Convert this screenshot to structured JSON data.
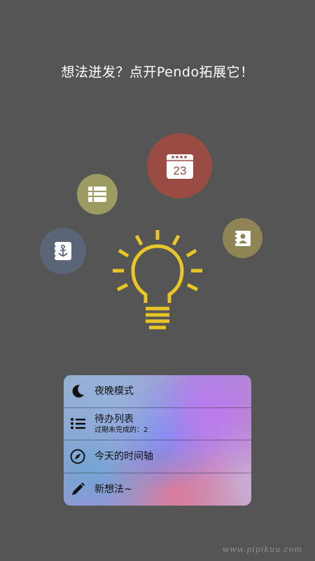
{
  "headline": "想法迸发？点开Pendo拓展它！",
  "feature_icons": [
    {
      "name": "calendar-icon",
      "label": "23",
      "color": "#9a4c42"
    },
    {
      "name": "list-grid-icon",
      "color": "#9b9b62"
    },
    {
      "name": "contact-card-icon",
      "color": "#8f8456"
    },
    {
      "name": "anchor-note-icon",
      "color": "#5a6577"
    }
  ],
  "center_icon": {
    "name": "lightbulb-icon",
    "color": "#e8c626"
  },
  "menu": {
    "items": [
      {
        "label": "夜晚模式",
        "icon": "moon-icon"
      },
      {
        "label": "待办列表",
        "sub": "过期未完成的：2",
        "icon": "list-icon"
      },
      {
        "label": "今天的时间轴",
        "icon": "compass-icon"
      },
      {
        "label": "新想法~",
        "icon": "pencil-icon"
      }
    ]
  },
  "watermark": "www.pipikuu.com"
}
